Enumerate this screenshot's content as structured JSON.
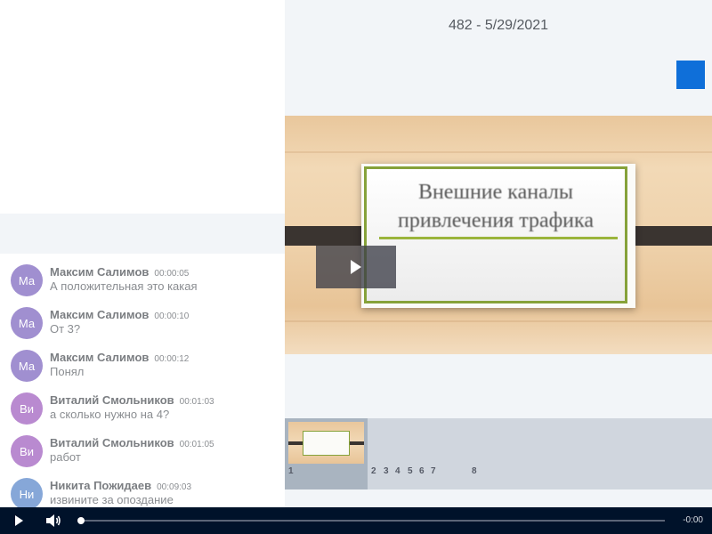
{
  "page": {
    "title": "482 - 5/29/2021"
  },
  "slide": {
    "title_line1": "Внешние каналы",
    "title_line2": "привлечения трафика"
  },
  "chat": {
    "messages": [
      {
        "initials": "Ма",
        "author": "Максим Салимов",
        "time": "00:00:05",
        "text": "А положительная это какая",
        "color": "#a08fd0"
      },
      {
        "initials": "Ма",
        "author": "Максим Салимов",
        "time": "00:00:10",
        "text": "От 3?",
        "color": "#a08fd0"
      },
      {
        "initials": "Ма",
        "author": "Максим Салимов",
        "time": "00:00:12",
        "text": "Понял",
        "color": "#a08fd0"
      },
      {
        "initials": "Ви",
        "author": "Виталий Смольников",
        "time": "00:01:03",
        "text": "а сколько нужно на 4?",
        "color": "#b98ad0"
      },
      {
        "initials": "Ви",
        "author": "Виталий Смольников",
        "time": "00:01:05",
        "text": "работ",
        "color": "#b98ad0"
      },
      {
        "initials": "Ни",
        "author": "Никита Пожидаев",
        "time": "00:09:03",
        "text": "извините за опоздание",
        "color": "#86a7d8"
      }
    ]
  },
  "thumbnails": {
    "numbers": [
      "1",
      "2",
      "3",
      "4",
      "5",
      "6",
      "7",
      "8"
    ],
    "thumb_title": "Внешние каналы привлечения трафика"
  },
  "player": {
    "time_remaining": "-0:00",
    "progress": 0.0
  },
  "colors": {
    "accent_blue": "#0f6fd9",
    "control_bar": "#00122a"
  },
  "icons": {
    "play": "play-icon",
    "volume": "volume-icon",
    "overlay_play": "play-icon"
  }
}
